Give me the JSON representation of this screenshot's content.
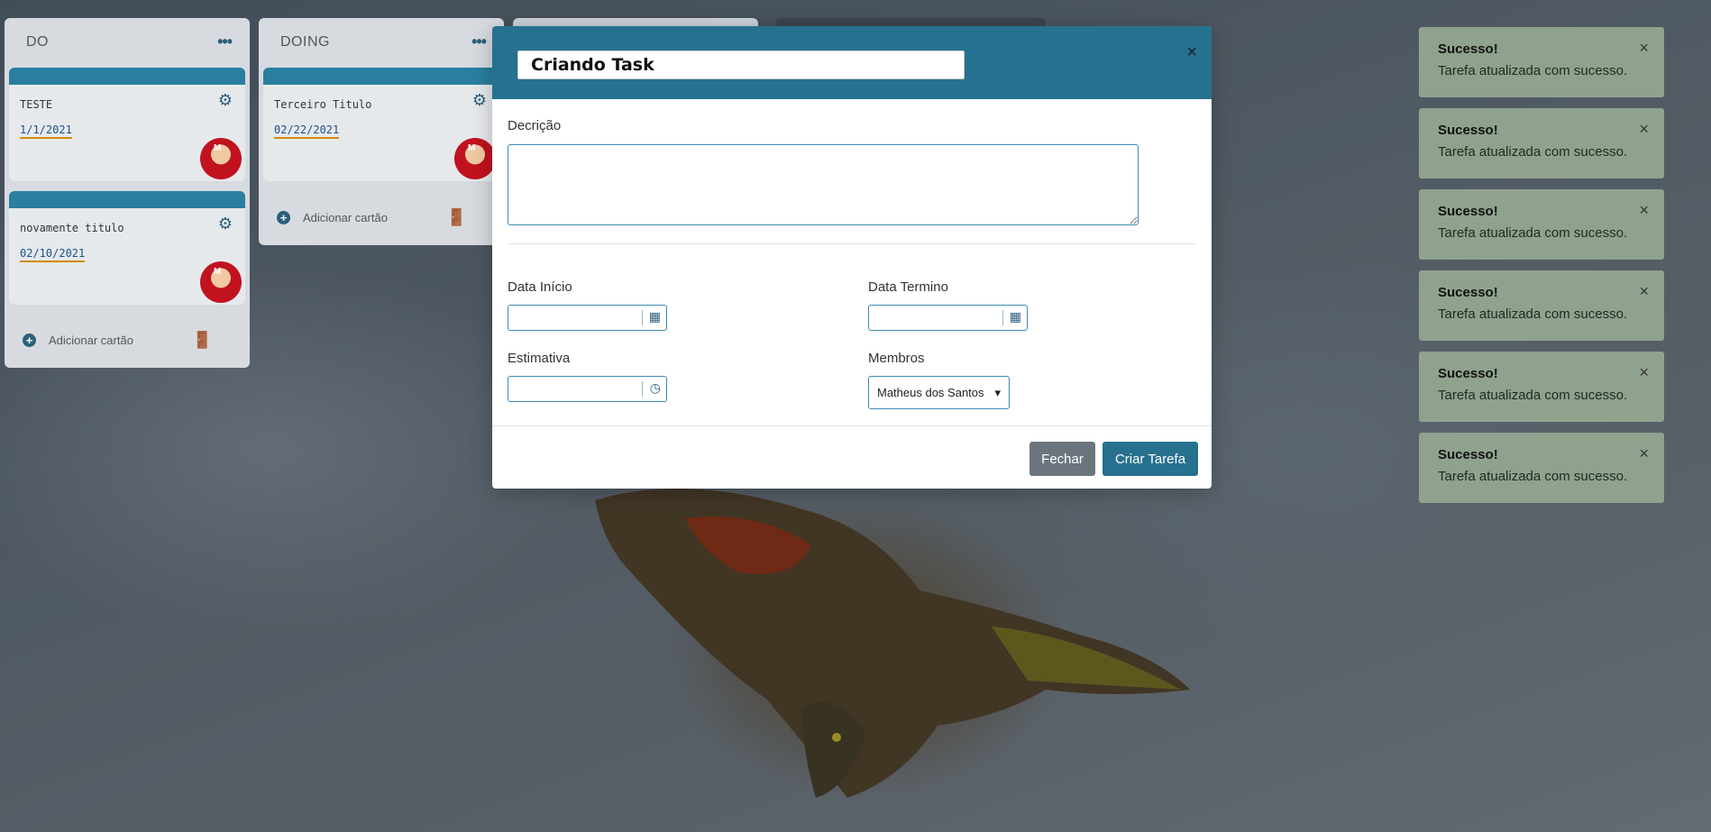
{
  "board": {
    "columns": [
      {
        "title": "DO",
        "cards": [
          {
            "title": "TESTE",
            "date": "1/1/2021"
          },
          {
            "title": "novamente titulo",
            "date": "02/10/2021"
          }
        ],
        "add_label": "Adicionar cartão"
      },
      {
        "title": "DOING",
        "cards": [
          {
            "title": "Terceiro Titulo",
            "date": "02/22/2021"
          }
        ],
        "add_label": "Adicionar cartão"
      }
    ],
    "menu_glyph": "•••",
    "gear_glyph": "⚙",
    "archive_glyph": "🚪",
    "avatar_initial": "M"
  },
  "modal": {
    "title_value": "Criando Task",
    "close_glyph": "×",
    "description_label": "Decrição",
    "description_value": "",
    "start_label": "Data Início",
    "end_label": "Data Termino",
    "estimate_label": "Estimativa",
    "members_label": "Membros",
    "members_selected": "Matheus dos Santos",
    "calendar_glyph": "▦",
    "clock_glyph": "◷",
    "close_button": "Fechar",
    "create_button": "Criar Tarefa"
  },
  "toasts": [
    {
      "title": "Sucesso!",
      "message": "Tarefa atualizada com sucesso."
    },
    {
      "title": "Sucesso!",
      "message": "Tarefa atualizada com sucesso."
    },
    {
      "title": "Sucesso!",
      "message": "Tarefa atualizada com sucesso."
    },
    {
      "title": "Sucesso!",
      "message": "Tarefa atualizada com sucesso."
    },
    {
      "title": "Sucesso!",
      "message": "Tarefa atualizada com sucesso."
    },
    {
      "title": "Sucesso!",
      "message": "Tarefa atualizada com sucesso."
    }
  ],
  "colors": {
    "primary": "#26718f",
    "secondary": "#6c757d",
    "toast_bg": "#8fa28e",
    "date_underline": "#d28a00"
  }
}
